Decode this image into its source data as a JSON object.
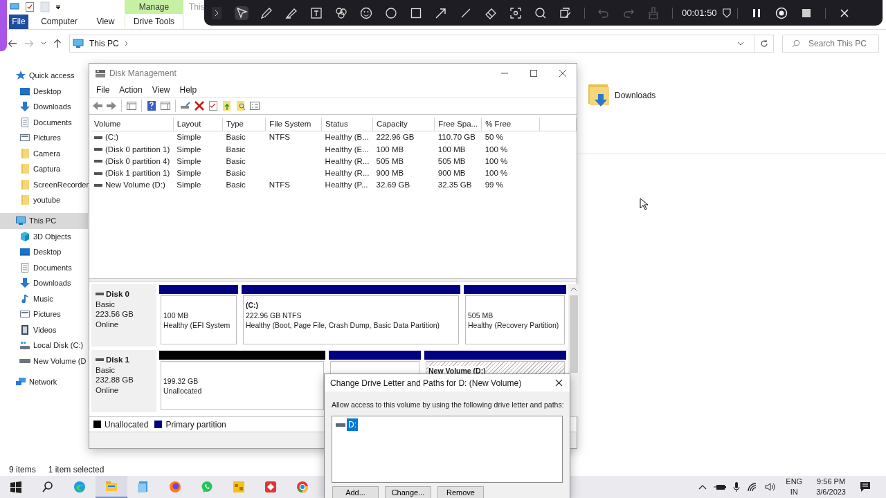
{
  "recorder_toolbar": {
    "tools": [
      {
        "kind": "expand",
        "selected": false
      },
      {
        "kind": "pointer",
        "selected": true
      },
      {
        "kind": "pen",
        "selected": false
      },
      {
        "kind": "highlighter",
        "selected": false
      },
      {
        "kind": "text",
        "selected": false
      },
      {
        "kind": "stickers",
        "selected": false
      },
      {
        "kind": "emoji",
        "selected": false
      },
      {
        "kind": "circle",
        "selected": false
      },
      {
        "kind": "square",
        "selected": false
      },
      {
        "kind": "arrow",
        "selected": false
      },
      {
        "kind": "line",
        "selected": false
      },
      {
        "kind": "eraser",
        "selected": false
      },
      {
        "kind": "screenshot",
        "selected": false
      },
      {
        "kind": "magnifier",
        "selected": false
      },
      {
        "kind": "whiteboard",
        "selected": false
      }
    ],
    "actions": [
      {
        "kind": "undo",
        "disabled": true
      },
      {
        "kind": "redo",
        "disabled": true
      },
      {
        "kind": "clear",
        "disabled": true
      }
    ],
    "timer": "00:01:50"
  },
  "explorer": {
    "title": "This",
    "ribbon_tabs": [
      {
        "label": "File",
        "kind": "file",
        "selected": false
      },
      {
        "label": "Computer",
        "kind": "tab",
        "selected": false
      },
      {
        "label": "View",
        "kind": "tab",
        "selected": false
      },
      {
        "label": "Drive Tools",
        "kind": "contextual",
        "group": "Manage",
        "selected": false
      }
    ],
    "address": {
      "crumbs": [
        "This PC"
      ]
    },
    "search": {
      "placeholder": "Search This PC"
    },
    "navigation": [
      {
        "label": "Quick access",
        "kind": "star",
        "selected": false,
        "children": [
          {
            "label": "Desktop",
            "kind": "desktop",
            "selected": false
          },
          {
            "label": "Downloads",
            "kind": "download",
            "selected": false
          },
          {
            "label": "Documents",
            "kind": "document",
            "selected": false
          },
          {
            "label": "Pictures",
            "kind": "pictures",
            "selected": false
          },
          {
            "label": "Camera",
            "kind": "folder",
            "selected": false
          },
          {
            "label": "Captura",
            "kind": "folder",
            "selected": false
          },
          {
            "label": "ScreenRecorder",
            "kind": "folder",
            "selected": false
          },
          {
            "label": "youtube",
            "kind": "folder",
            "selected": false
          }
        ]
      },
      {
        "label": "This PC",
        "kind": "pc",
        "selected": true,
        "children": [
          {
            "label": "3D Objects",
            "kind": "cube",
            "selected": false
          },
          {
            "label": "Desktop",
            "kind": "desktop",
            "selected": false
          },
          {
            "label": "Documents",
            "kind": "document",
            "selected": false
          },
          {
            "label": "Downloads",
            "kind": "download",
            "selected": false
          },
          {
            "label": "Music",
            "kind": "music",
            "selected": false
          },
          {
            "label": "Pictures",
            "kind": "pictures",
            "selected": false
          },
          {
            "label": "Videos",
            "kind": "video",
            "selected": false
          },
          {
            "label": "Local Disk (C:)",
            "kind": "localdisk",
            "selected": false
          },
          {
            "label": "New Volume (D",
            "kind": "drive",
            "selected": false
          }
        ]
      },
      {
        "label": "Network",
        "kind": "network",
        "selected": false
      }
    ],
    "items": [
      {
        "label": "Downloads",
        "kind": "downloads-folder"
      }
    ],
    "status_bar": {
      "item_count": "9 items",
      "selection": "1 item selected"
    }
  },
  "disk_management": {
    "title": "Disk Management",
    "menu": [
      "File",
      "Action",
      "View",
      "Help"
    ],
    "columns": [
      "Volume",
      "Layout",
      "Type",
      "File System",
      "Status",
      "Capacity",
      "Free Spa...",
      "% Free"
    ],
    "rows": [
      {
        "volume": "(C:)",
        "layout": "Simple",
        "type": "Basic",
        "file_system": "NTFS",
        "status": "Healthy (B...",
        "capacity": "222.96 GB",
        "free_space": "110.70 GB",
        "percent_free": "50 %"
      },
      {
        "volume": "(Disk 0 partition 1)",
        "layout": "Simple",
        "type": "Basic",
        "status": "Healthy (E...",
        "capacity": "100 MB",
        "free_space": "100 MB",
        "percent_free": "100 %"
      },
      {
        "volume": "(Disk 0 partition 4)",
        "layout": "Simple",
        "type": "Basic",
        "status": "Healthy (R...",
        "capacity": "505 MB",
        "free_space": "505 MB",
        "percent_free": "100 %"
      },
      {
        "volume": "(Disk 1 partition 1)",
        "layout": "Simple",
        "type": "Basic",
        "status": "Healthy (R...",
        "capacity": "900 MB",
        "free_space": "900 MB",
        "percent_free": "100 %"
      },
      {
        "volume": "New Volume (D:)",
        "layout": "Simple",
        "type": "Basic",
        "file_system": "NTFS",
        "status": "Healthy (P...",
        "capacity": "32.69 GB",
        "free_space": "32.35 GB",
        "percent_free": "99 %"
      }
    ],
    "disks": [
      {
        "name": "Disk 0",
        "type": "Basic",
        "size": "223.56 GB",
        "status": "Online",
        "partitions": [
          {
            "kind": "primary",
            "selected": false,
            "lines": [
              "100 MB",
              "Healthy (EFI System"
            ]
          },
          {
            "kind": "primary",
            "selected": false,
            "label": "(C:)",
            "lines": [
              "222.96 GB NTFS",
              "Healthy (Boot, Page File, Crash Dump, Basic Data Partition)"
            ]
          },
          {
            "kind": "primary",
            "selected": false,
            "lines": [
              "505 MB",
              "Healthy (Recovery Partition)"
            ]
          }
        ]
      },
      {
        "name": "Disk 1",
        "type": "Basic",
        "size": "232.88 GB",
        "status": "Online",
        "partitions": [
          {
            "kind": "unallocated",
            "selected": false,
            "lines": [
              "199.32 GB",
              "Unallocated"
            ]
          },
          {
            "kind": "primary",
            "selected": false
          },
          {
            "kind": "primary",
            "selected": true,
            "label": "New Volume  (D:)"
          }
        ]
      }
    ],
    "legend": [
      {
        "label": "Unallocated",
        "color": "#000000"
      },
      {
        "label": "Primary partition",
        "color": "#000080"
      }
    ]
  },
  "dialog": {
    "title": "Change Drive Letter and Paths for D: (New Volume)",
    "prompt": "Allow access to this volume by using the following drive letter and paths:",
    "paths": [
      {
        "label": "D:",
        "selected": true
      }
    ],
    "buttons": [
      "Add...",
      "Change...",
      "Remove"
    ]
  },
  "taskbar": {
    "apps": [
      {
        "kind": "start",
        "active": false
      },
      {
        "kind": "search",
        "active": false
      },
      {
        "kind": "edge",
        "active": false
      },
      {
        "kind": "explorer",
        "active": true
      },
      {
        "kind": "blueapp",
        "active": false
      },
      {
        "kind": "firefox",
        "active": false
      },
      {
        "kind": "whatsapp",
        "active": false
      },
      {
        "kind": "yellowapp",
        "active": false
      },
      {
        "kind": "redapp",
        "active": false
      },
      {
        "kind": "chrome",
        "active": false
      }
    ],
    "language": [
      "ENG",
      "IN"
    ],
    "time": "9:56 PM",
    "date": "3/6/2023"
  }
}
